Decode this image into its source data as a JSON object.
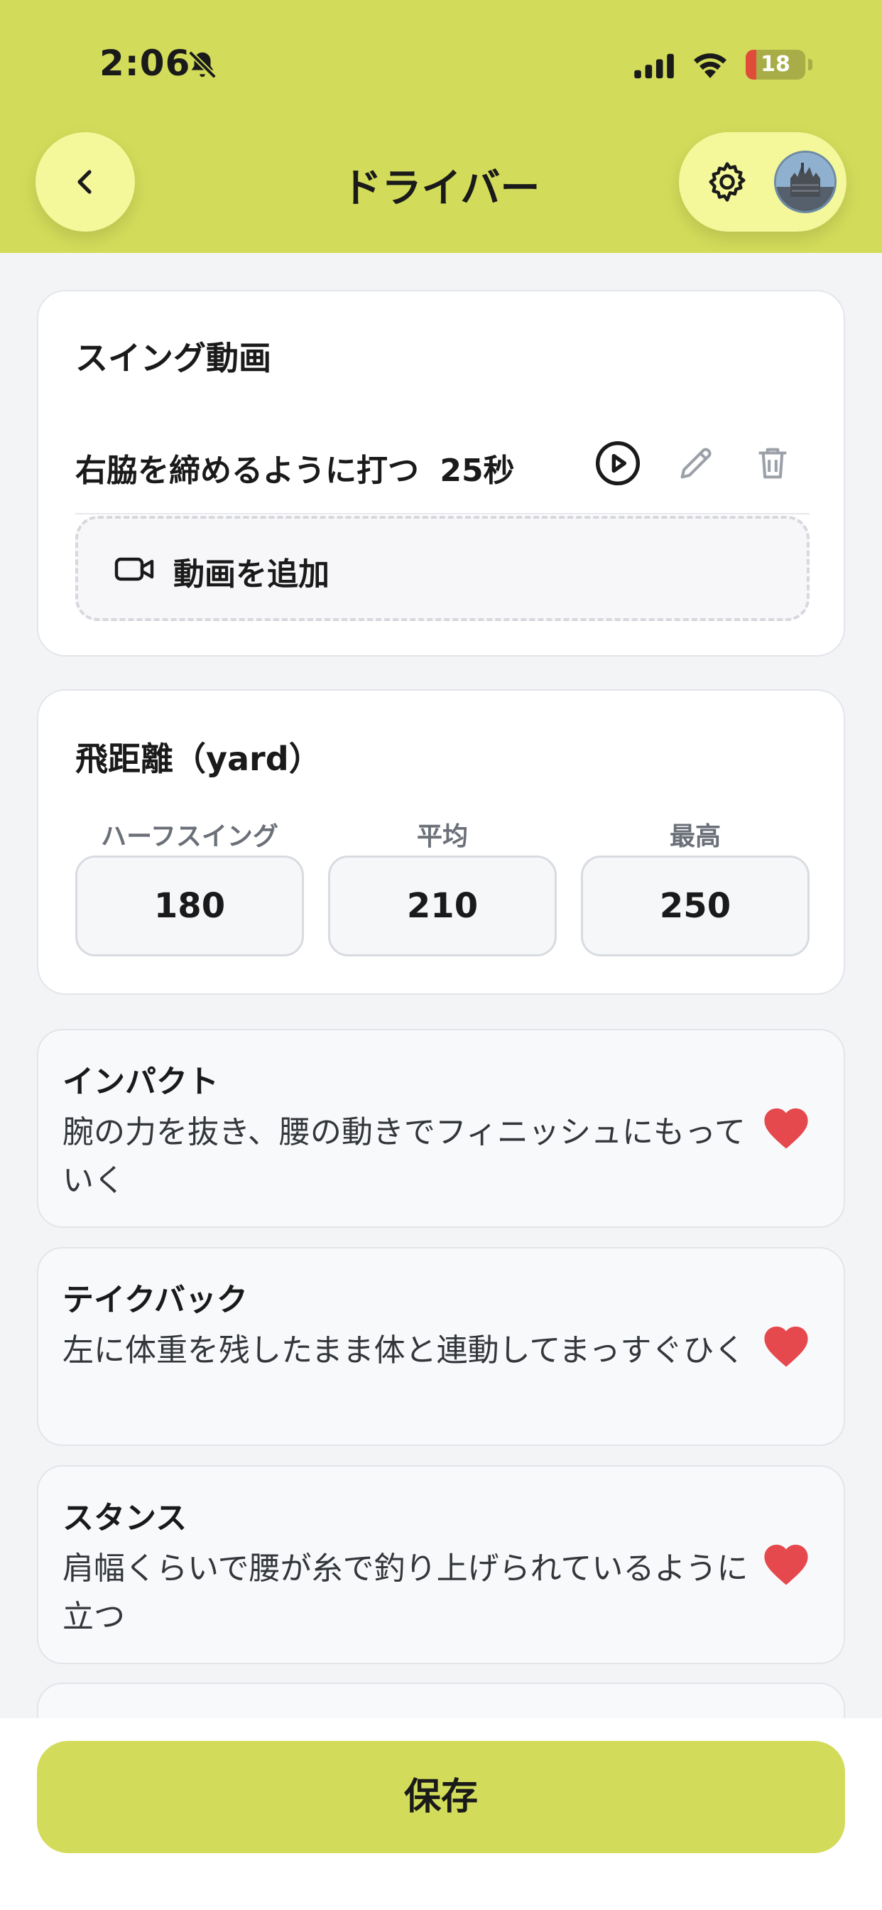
{
  "status_bar": {
    "time": "2:06",
    "battery": "18",
    "battery_level": 0.18
  },
  "header": {
    "title": "ドライバー"
  },
  "swing_video": {
    "title": "スイング動画",
    "videos": [
      {
        "label": "右脇を締めるように打つ",
        "duration": "25秒"
      }
    ],
    "add_label": "動画を追加"
  },
  "distance": {
    "title": "飛距離（yard）",
    "fields": [
      {
        "label": "ハーフスイング",
        "value": "180"
      },
      {
        "label": "平均",
        "value": "210"
      },
      {
        "label": "最高",
        "value": "250"
      }
    ]
  },
  "points": [
    {
      "title": "インパクト",
      "desc": "腕の力を抜き、腰の動きでフィニッシュにもっていく",
      "favorite": true
    },
    {
      "title": "テイクバック",
      "desc": "左に体重を残したまま体と連動してまっすぐひく",
      "favorite": true
    },
    {
      "title": "スタンス",
      "desc": "肩幅くらいで腰が糸で釣り上げられているように立つ",
      "favorite": true
    }
  ],
  "save_label": "保存",
  "colors": {
    "accent": "#d3dc5a",
    "pill": "#f4f79a",
    "heart": "#e5484d"
  }
}
